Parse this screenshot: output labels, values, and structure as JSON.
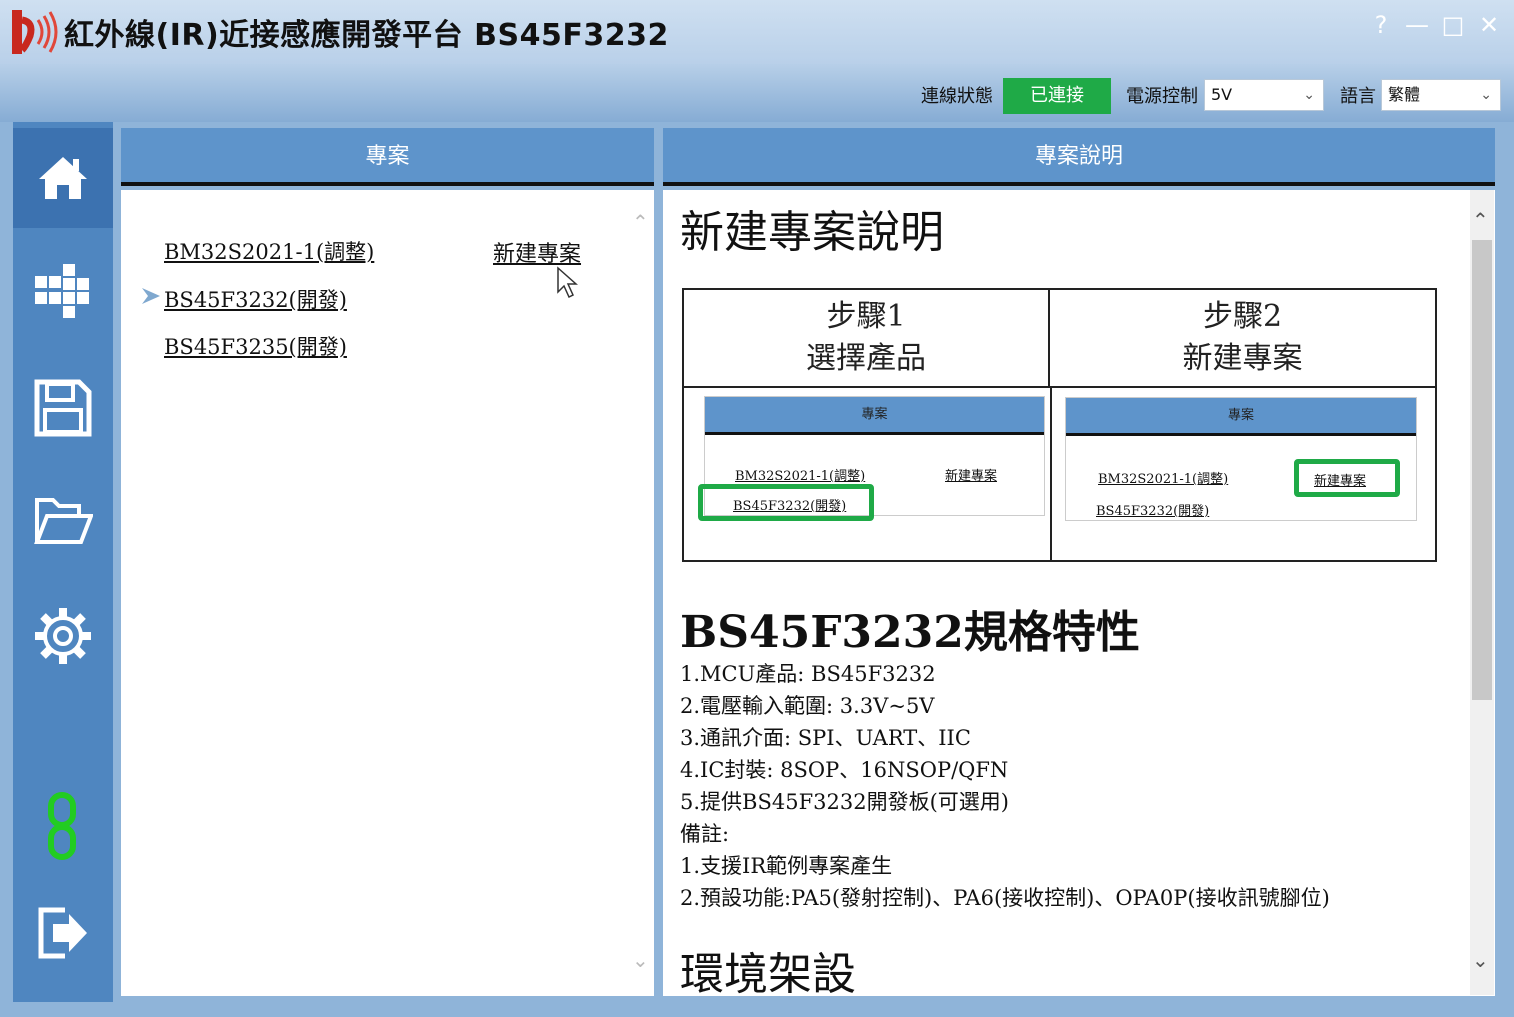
{
  "window": {
    "title": "紅外線(IR)近接感應開發平台 BS45F3232",
    "help": "?",
    "minimize": "—",
    "maximize": "□",
    "close": "✕"
  },
  "toolbar": {
    "conn_label": "連線狀態",
    "conn_status": "已連接",
    "power_label": "電源控制",
    "power_value": "5V",
    "lang_label": "語言",
    "lang_value": "繁體"
  },
  "sidebar": {
    "items": [
      "home-icon",
      "modules-icon",
      "save-icon",
      "open-folder-icon",
      "settings-icon",
      "link-icon",
      "exit-icon"
    ]
  },
  "projects": {
    "header": "專案",
    "new_project": "新建專案",
    "items": [
      "BM32S2021-1(調整)",
      "BS45F3232(開發)",
      "BS45F3235(開發)"
    ]
  },
  "description": {
    "header": "專案說明",
    "title": "新建專案說明",
    "step1_line1": "步驟1",
    "step1_line2": "選擇產品",
    "step2_line1": "步驟2",
    "step2_line2": "新建專案",
    "mini_header": "專案",
    "mini_item1": "BM32S2021-1(調整)",
    "mini_item2": "BS45F3232(開發)",
    "mini_new": "新建專案",
    "spec_title": "BS45F3232規格特性",
    "spec_lines": [
      "1.MCU產品: BS45F3232",
      "2.電壓輸入範圍: 3.3V~5V",
      "3.通訊介面: SPI、UART、IIC",
      "4.IC封裝: 8SOP、16NSOP/QFN",
      "5.提供BS45F3232開發板(可選用)",
      "備註:",
      "1.支援IR範例專案產生",
      "2.預設功能:PA5(發射控制)、PA6(接收控制)、OPA0P(接收訊號腳位)"
    ],
    "env_title": "環境架設"
  },
  "colors": {
    "connected": "#1faa47",
    "accent": "#5e94cb",
    "sidebar": "#4f86c0",
    "link_icon": "#22cc22"
  }
}
